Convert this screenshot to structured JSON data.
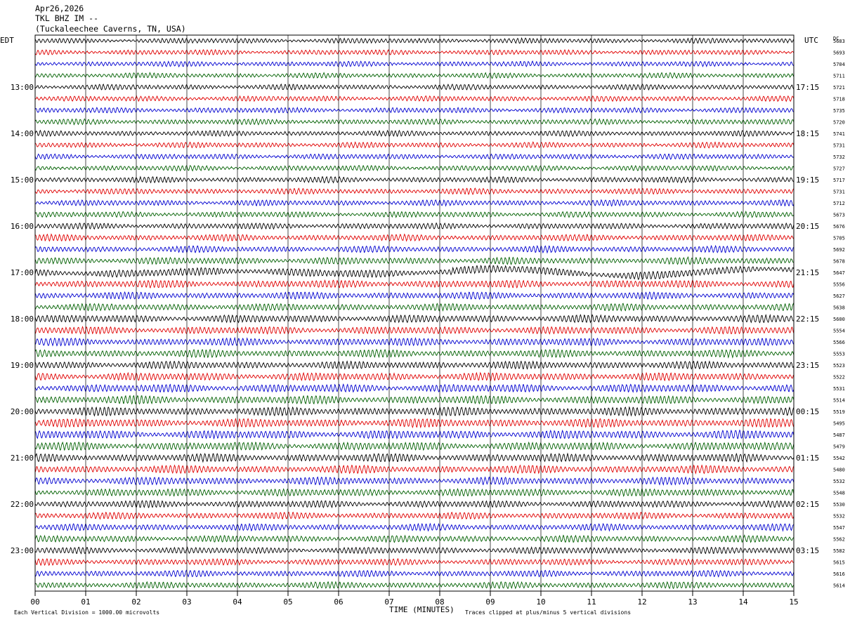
{
  "header": {
    "date": "Apr26,2026",
    "station": "TKL BHZ IM --",
    "location": "(Tuckaleechee Caverns, TN, USA)"
  },
  "left_axis_title": "EDT",
  "right_axis_title": "UTC",
  "dc_label": "DC",
  "footer": {
    "scale_note": "Each Vertical Division = 1000.00 microvolts",
    "clip_note": "Traces clipped at plus/minus 5 vertical divisions",
    "x_axis_title": "TIME (MINUTES)"
  },
  "colors": {
    "trace_cycle": [
      "#000000",
      "#e00000",
      "#0000d0",
      "#006000"
    ],
    "grid": "#000000",
    "background": "#ffffff"
  },
  "chart_data": {
    "type": "line",
    "title": "TKL BHZ IM --",
    "xlabel": "TIME (MINUTES)",
    "xlim": [
      0,
      15
    ],
    "x_tick_labels": [
      "00",
      "01",
      "02",
      "03",
      "04",
      "05",
      "06",
      "07",
      "08",
      "09",
      "10",
      "11",
      "12",
      "13",
      "14",
      "15"
    ],
    "left_time_labels": [
      {
        "row": 4,
        "label": "13:00"
      },
      {
        "row": 8,
        "label": "14:00"
      },
      {
        "row": 12,
        "label": "15:00"
      },
      {
        "row": 16,
        "label": "16:00"
      },
      {
        "row": 20,
        "label": "17:00"
      },
      {
        "row": 24,
        "label": "18:00"
      },
      {
        "row": 28,
        "label": "19:00"
      },
      {
        "row": 32,
        "label": "20:00"
      },
      {
        "row": 36,
        "label": "21:00"
      },
      {
        "row": 40,
        "label": "22:00"
      },
      {
        "row": 44,
        "label": "23:00"
      }
    ],
    "right_time_labels": [
      {
        "row": 4,
        "label": "17:15"
      },
      {
        "row": 8,
        "label": "18:15"
      },
      {
        "row": 12,
        "label": "19:15"
      },
      {
        "row": 16,
        "label": "20:15"
      },
      {
        "row": 20,
        "label": "21:15"
      },
      {
        "row": 24,
        "label": "22:15"
      },
      {
        "row": 28,
        "label": "23:15"
      },
      {
        "row": 32,
        "label": "00:15"
      },
      {
        "row": 36,
        "label": "01:15"
      },
      {
        "row": 40,
        "label": "02:15"
      },
      {
        "row": 44,
        "label": "03:15"
      }
    ],
    "dc_offsets": [
      "5683",
      "5693",
      "5704",
      "5711",
      "5721",
      "5718",
      "5735",
      "5720",
      "5741",
      "5731",
      "5732",
      "5727",
      "5717",
      "5731",
      "5712",
      "5673",
      "5676",
      "5705",
      "5692",
      "5678",
      "5647",
      "5556",
      "5627",
      "5638",
      "5600",
      "5554",
      "5566",
      "5553",
      "5523",
      "5522",
      "5531",
      "5514",
      "5519",
      "5495",
      "5487",
      "5479",
      "5542",
      "5480",
      "5532",
      "5548",
      "5530",
      "5532",
      "5547",
      "5562",
      "5582",
      "5615",
      "5616",
      "5614"
    ],
    "trace_count": 48,
    "trace_activity": [
      0.8,
      0.8,
      0.8,
      0.8,
      0.85,
      0.85,
      0.85,
      0.85,
      0.85,
      0.85,
      0.85,
      0.85,
      0.9,
      0.9,
      0.9,
      0.9,
      0.95,
      1.0,
      1.0,
      1.1,
      1.3,
      1.2,
      1.1,
      1.1,
      1.2,
      1.2,
      1.2,
      1.2,
      1.2,
      1.25,
      1.3,
      1.3,
      1.35,
      1.35,
      1.35,
      1.3,
      1.3,
      1.25,
      1.2,
      1.2,
      1.1,
      1.05,
      1.05,
      1.05,
      1.05,
      1.0,
      1.0,
      1.0
    ],
    "grid": true,
    "vertical_grid_every_minutes": 1
  }
}
